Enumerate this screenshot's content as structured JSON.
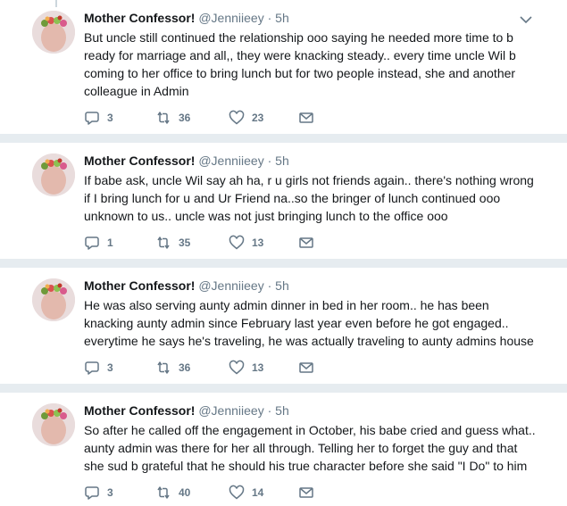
{
  "tweets": [
    {
      "name": "Mother Confessor!",
      "handle": "@Jenniieey",
      "dot": "·",
      "time": "5h",
      "text": "But uncle still continued the relationship ooo saying he needed more time to b ready for marriage and all,, they were knacking steady.. every time uncle Wil b coming to her office to bring lunch but for two people instead, she and another colleague in Admin",
      "replies": "3",
      "retweets": "36",
      "likes": "23"
    },
    {
      "name": "Mother Confessor!",
      "handle": "@Jenniieey",
      "dot": "·",
      "time": "5h",
      "text": "If babe ask, uncle Wil say ah ha, r u girls not friends again.. there's nothing wrong if I bring lunch for u and Ur Friend na..so the bringer of lunch continued ooo unknown to us.. uncle was not just bringing lunch to the office ooo",
      "replies": "1",
      "retweets": "35",
      "likes": "13"
    },
    {
      "name": "Mother Confessor!",
      "handle": "@Jenniieey",
      "dot": "·",
      "time": "5h",
      "text": "He was also serving aunty admin dinner in bed in her room.. he has been knacking aunty admin since February last year even before he got engaged.. everytime he says he's traveling, he was actually traveling to aunty admins house",
      "replies": "3",
      "retweets": "36",
      "likes": "13"
    },
    {
      "name": "Mother Confessor!",
      "handle": "@Jenniieey",
      "dot": "·",
      "time": "5h",
      "text": "So after he called off the engagement in October, his babe cried and guess what.. aunty admin was there for her all through. Telling her to forget the guy and that she sud b grateful that he should his true character before she said \"I Do\" to him",
      "replies": "3",
      "retweets": "40",
      "likes": "14"
    }
  ],
  "icons": {
    "reply": "reply-icon",
    "retweet": "retweet-icon",
    "like": "heart-icon",
    "dm": "envelope-icon",
    "more": "chevron-down-icon"
  },
  "colors": {
    "icon": "#657786",
    "background": "#e6ecf0",
    "thread_line": "#ccd6dd"
  }
}
